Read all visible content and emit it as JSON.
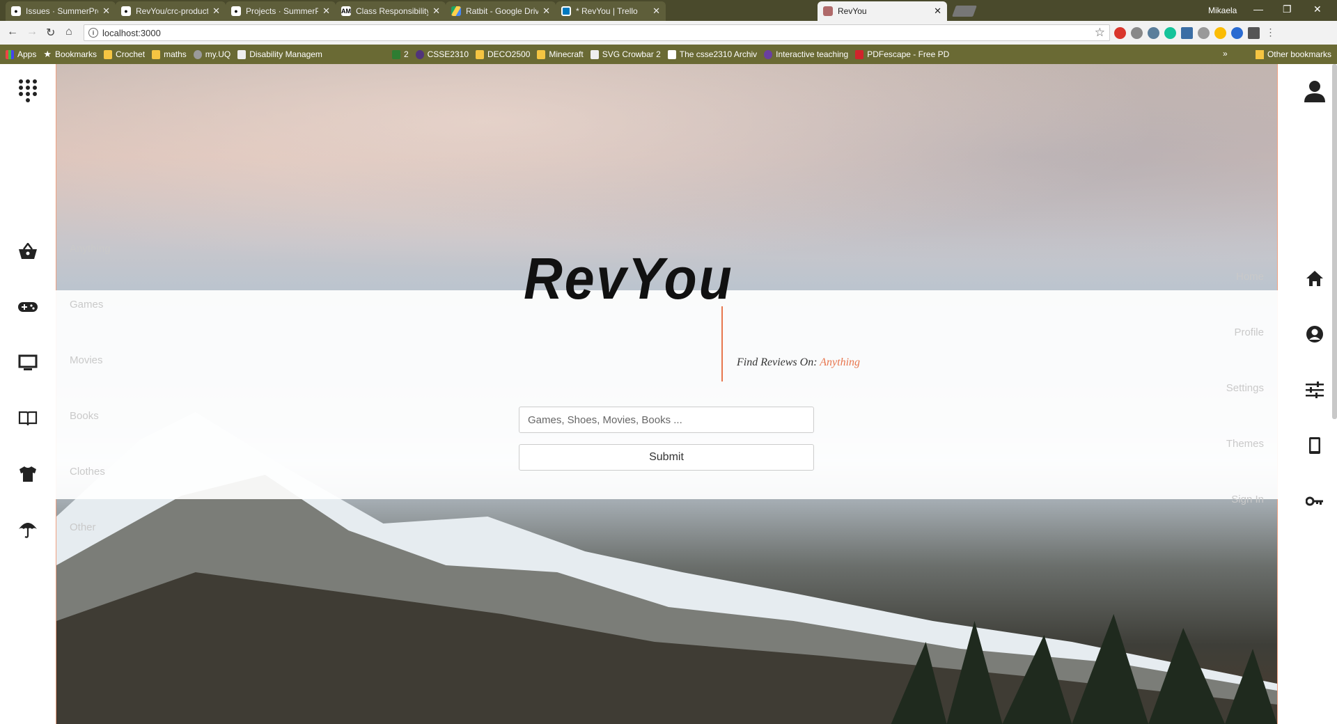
{
  "browser": {
    "tabs": [
      {
        "title": "Issues · SummerProgram",
        "icon": "github-icon",
        "active": false
      },
      {
        "title": "RevYou/crc-product.jpg a",
        "icon": "github-icon",
        "active": false
      },
      {
        "title": "Projects · SummerProgra",
        "icon": "github-icon",
        "active": false
      },
      {
        "title": "Class Responsibility Colla",
        "icon": "am-icon",
        "active": false
      },
      {
        "title": "Ratbit - Google Drive",
        "icon": "google-drive-icon",
        "active": false
      },
      {
        "title": "* RevYou | Trello",
        "icon": "trello-icon",
        "active": false
      },
      {
        "title": "RevYou",
        "icon": "revyou-icon",
        "active": true
      }
    ],
    "user": "Mikaela",
    "url": "localhost:3000",
    "bookmarks": [
      {
        "label": "Apps"
      },
      {
        "label": "Bookmarks"
      },
      {
        "label": "Crochet"
      },
      {
        "label": "maths"
      },
      {
        "label": "my.UQ"
      },
      {
        "label": "Disability Managem"
      },
      {
        "label": "2"
      },
      {
        "label": "CSSE2310"
      },
      {
        "label": "DECO2500"
      },
      {
        "label": "Minecraft"
      },
      {
        "label": "SVG Crowbar 2"
      },
      {
        "label": "The csse2310 Archiv"
      },
      {
        "label": "Interactive teaching"
      },
      {
        "label": "PDFescape - Free PD"
      }
    ],
    "other_bookmarks": "Other bookmarks",
    "more_bookmarks": "»"
  },
  "page": {
    "categories": [
      "Anything",
      "Games",
      "Movies",
      "Books",
      "Clothes",
      "Other"
    ],
    "nav": [
      "Home",
      "Profile",
      "Settings",
      "Themes",
      "Sign In"
    ],
    "logo": "RevYou",
    "tagline_prefix": "Find Reviews On:",
    "tagline_value": "Anything",
    "search_placeholder": "Games, Shoes, Movies, Books ...",
    "submit_label": "Submit"
  },
  "colors": {
    "accent": "#e8764e",
    "rail_icon": "#222222"
  }
}
